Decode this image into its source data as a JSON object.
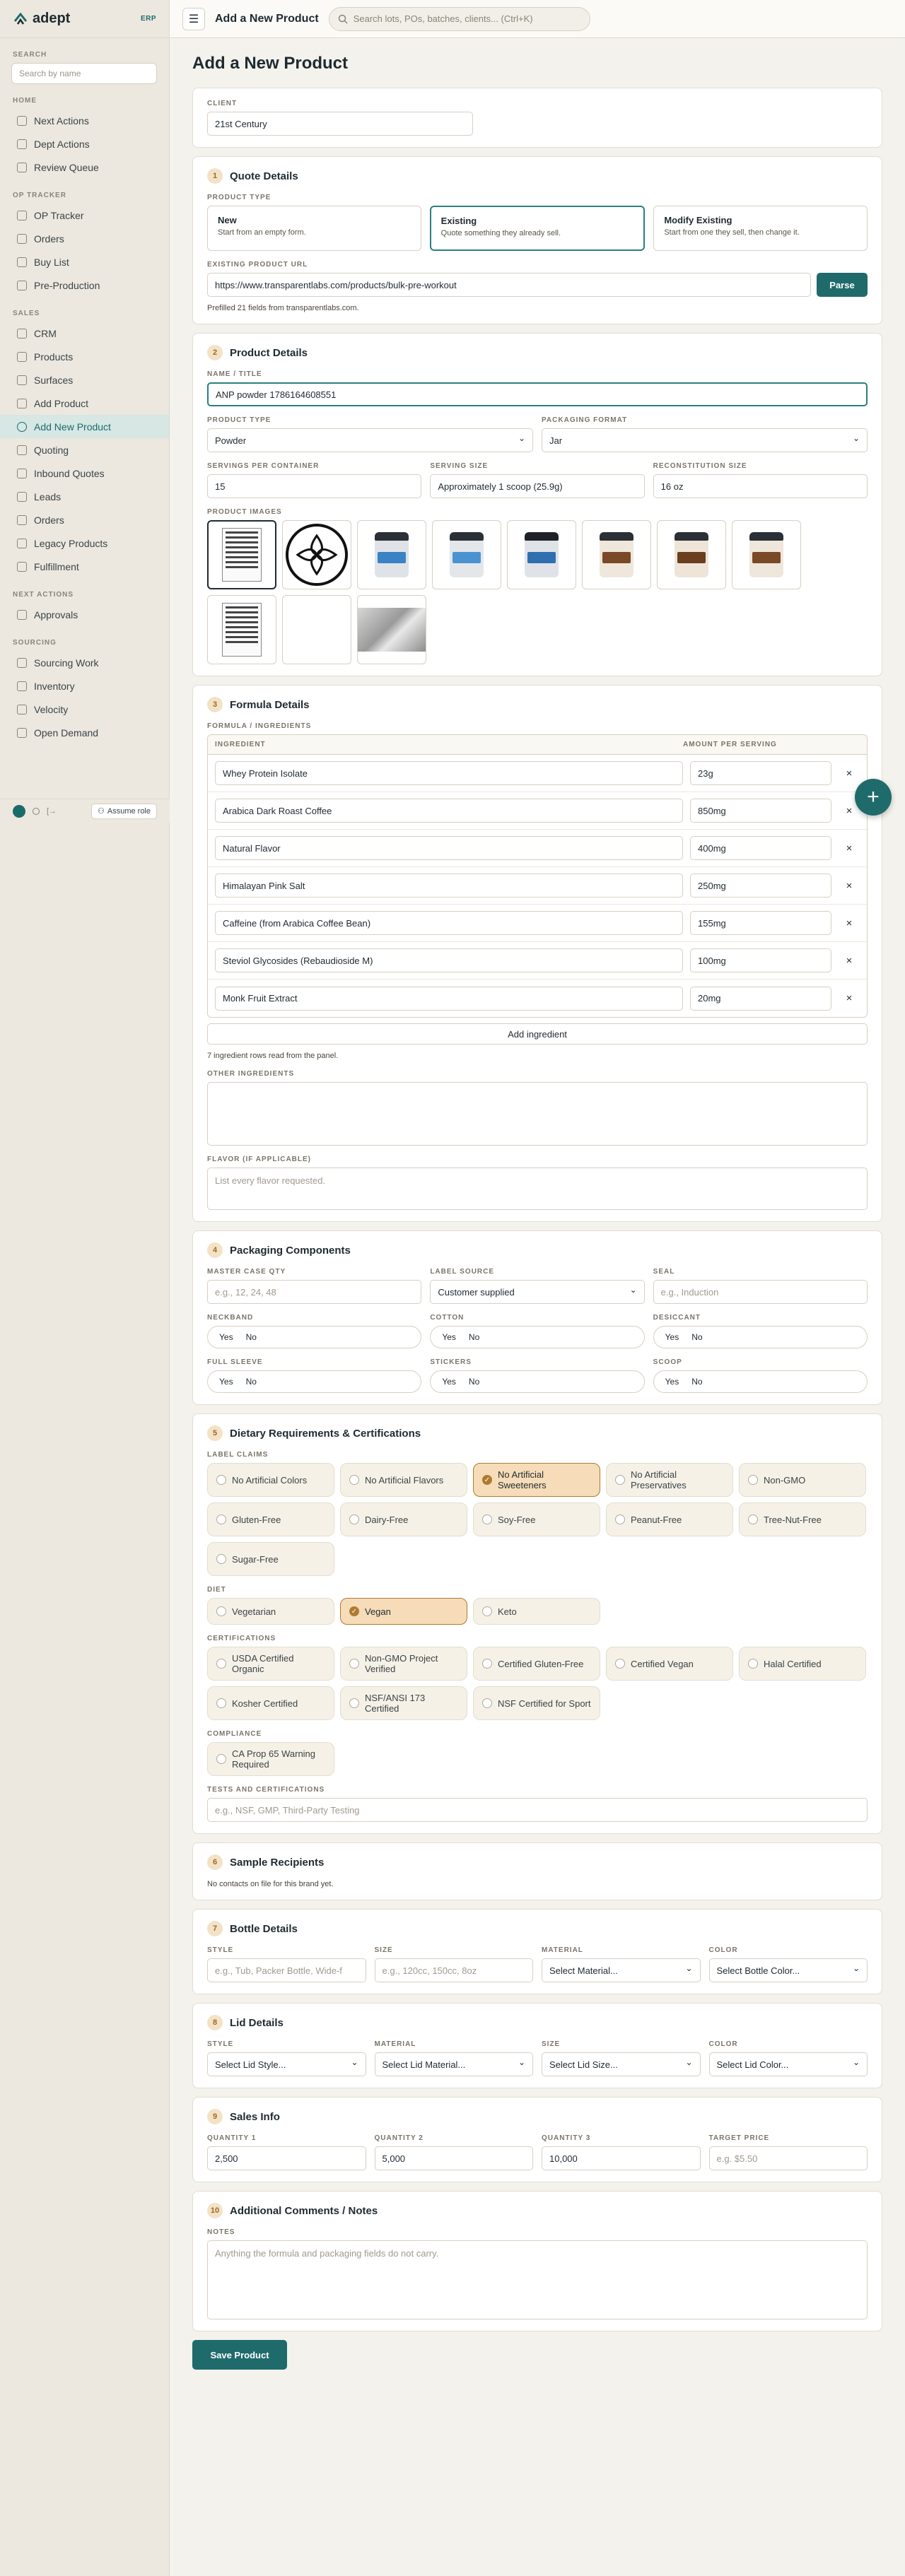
{
  "sidebar": {
    "brand": "adept",
    "env": "ERP",
    "search_label": "SEARCH",
    "search_placeholder": "Search by name",
    "groups": [
      {
        "label": "HOME",
        "items": [
          "Next Actions",
          "Dept Actions",
          "Review Queue"
        ]
      },
      {
        "label": "OP TRACKER",
        "items": [
          "OP Tracker",
          "Orders",
          "Buy List",
          "Pre-Production"
        ]
      },
      {
        "label": "SALES",
        "items": [
          "CRM",
          "Products",
          "Surfaces",
          "Add Product",
          "Add New Product",
          "Quoting",
          "Inbound Quotes",
          "Leads",
          "Orders",
          "Legacy Products",
          "Fulfillment"
        ]
      },
      {
        "label": "NEXT ACTIONS",
        "items": [
          "Approvals"
        ]
      },
      {
        "label": "SOURCING",
        "items": [
          "Sourcing Work",
          "Inventory",
          "Velocity",
          "Open Demand"
        ]
      }
    ],
    "active_item": "Add New Product",
    "assume_role": "Assume role"
  },
  "topbar": {
    "title": "Add a New Product",
    "search_placeholder": "Search lots, POs, batches, clients... (Ctrl+K)"
  },
  "page": {
    "title": "Add a New Product",
    "client_label": "CLIENT",
    "client_value": "21st Century"
  },
  "quote": {
    "num": "1",
    "title": "Quote Details",
    "type_label": "PRODUCT TYPE",
    "options": [
      {
        "title": "New",
        "desc": "Start from an empty form."
      },
      {
        "title": "Existing",
        "desc": "Quote something they already sell."
      },
      {
        "title": "Modify Existing",
        "desc": "Start from one they sell, then change it."
      }
    ],
    "selected": "Existing",
    "url_label": "EXISTING PRODUCT URL",
    "url_value": "https://www.transparentlabs.com/products/bulk-pre-workout",
    "parse_label": "Parse",
    "prefill_note": "Prefilled 21 fields from transparentlabs.com."
  },
  "product": {
    "num": "2",
    "title": "Product Details",
    "name_label": "NAME / TITLE",
    "name_value": "ANP powder 1786164608551",
    "type_label": "PRODUCT TYPE",
    "type_value": "Powder",
    "format_label": "PACKAGING FORMAT",
    "format_value": "Jar",
    "servings_label": "SERVINGS PER CONTAINER",
    "servings_value": "15",
    "serving_size_label": "SERVING SIZE",
    "serving_size_value": "Approximately 1 scoop (25.9g)",
    "recon_label": "RECONSTITUTION SIZE",
    "recon_value": "16 oz",
    "images_label": "PRODUCT IMAGES"
  },
  "formula": {
    "num": "3",
    "title": "Formula Details",
    "ingredients_label": "FORMULA / INGREDIENTS",
    "col_ingredient": "INGREDIENT",
    "col_amount": "AMOUNT PER SERVING",
    "rows": [
      {
        "name": "Whey Protein Isolate",
        "amount": "23g"
      },
      {
        "name": "Arabica Dark Roast Coffee",
        "amount": "850mg"
      },
      {
        "name": "Natural Flavor",
        "amount": "400mg"
      },
      {
        "name": "Himalayan Pink Salt",
        "amount": "250mg"
      },
      {
        "name": "Caffeine (from Arabica Coffee Bean)",
        "amount": "155mg"
      },
      {
        "name": "Steviol Glycosides (Rebaudioside M)",
        "amount": "100mg"
      },
      {
        "name": "Monk Fruit Extract",
        "amount": "20mg"
      }
    ],
    "remove_glyph": "×",
    "add_label": "Add ingredient",
    "rows_note": "7 ingredient rows read from the panel.",
    "other_label": "OTHER INGREDIENTS",
    "flavor_label": "FLAVOR (IF APPLICABLE)",
    "flavor_placeholder": "List every flavor requested."
  },
  "packaging": {
    "num": "4",
    "title": "Packaging Components",
    "master_label": "MASTER CASE QTY",
    "master_placeholder": "e.g., 12, 24, 48",
    "label_source_label": "LABEL SOURCE",
    "label_source_value": "Customer supplied",
    "seal_label": "SEAL",
    "seal_placeholder": "e.g., Induction",
    "yes": "Yes",
    "no": "No",
    "toggles": [
      "NECKBAND",
      "COTTON",
      "DESICCANT",
      "FULL SLEEVE",
      "STICKERS",
      "SCOOP"
    ]
  },
  "dietary": {
    "num": "5",
    "title": "Dietary Requirements & Certifications",
    "claims_label": "LABEL CLAIMS",
    "claims": [
      "No Artificial Colors",
      "No Artificial Flavors",
      "No Artificial Sweeteners",
      "No Artificial Preservatives",
      "Non-GMO",
      "Gluten-Free",
      "Dairy-Free",
      "Soy-Free",
      "Peanut-Free",
      "Tree-Nut-Free",
      "Sugar-Free"
    ],
    "claims_selected": [
      "No Artificial Sweeteners"
    ],
    "diet_label": "DIET",
    "diet": [
      "Vegetarian",
      "Vegan",
      "Keto"
    ],
    "diet_selected": [
      "Vegan"
    ],
    "cert_label": "CERTIFICATIONS",
    "certs": [
      "USDA Certified Organic",
      "Non-GMO Project Verified",
      "Certified Gluten-Free",
      "Certified Vegan",
      "Halal Certified",
      "Kosher Certified",
      "NSF/ANSI 173 Certified",
      "NSF Certified for Sport"
    ],
    "compliance_label": "COMPLIANCE",
    "compliance": [
      "CA Prop 65 Warning Required"
    ],
    "tests_label": "TESTS AND CERTIFICATIONS",
    "tests_placeholder": "e.g., NSF, GMP, Third-Party Testing"
  },
  "samples": {
    "num": "6",
    "title": "Sample Recipients",
    "note": "No contacts on file for this brand yet."
  },
  "bottle": {
    "num": "7",
    "title": "Bottle Details",
    "style_label": "STYLE",
    "style_placeholder": "e.g., Tub, Packer Bottle, Wide-f",
    "size_label": "SIZE",
    "size_placeholder": "e.g., 120cc, 150cc, 8oz",
    "material_label": "MATERIAL",
    "material_value": "Select Material...",
    "color_label": "COLOR",
    "color_value": "Select Bottle Color..."
  },
  "lid": {
    "num": "8",
    "title": "Lid Details",
    "style_label": "STYLE",
    "style_value": "Select Lid Style...",
    "material_label": "MATERIAL",
    "material_value": "Select Lid Material...",
    "size_label": "SIZE",
    "size_value": "Select Lid Size...",
    "color_label": "COLOR",
    "color_value": "Select Lid Color..."
  },
  "sales": {
    "num": "9",
    "title": "Sales Info",
    "q1_label": "QUANTITY 1",
    "q1_value": "2,500",
    "q2_label": "QUANTITY 2",
    "q2_value": "5,000",
    "q3_label": "QUANTITY 3",
    "q3_value": "10,000",
    "price_label": "TARGET PRICE",
    "price_placeholder": "e.g. $5.50"
  },
  "comments": {
    "num": "10",
    "title": "Additional Comments / Notes",
    "notes_label": "NOTES",
    "notes_placeholder": "Anything the formula and packaging fields do not carry."
  },
  "save_label": "Save Product",
  "fab_glyph": "+",
  "colors": {
    "accent": "#1f6b6b",
    "chip_selected": "#f6dcb8",
    "badge": "#f3e2c6"
  }
}
